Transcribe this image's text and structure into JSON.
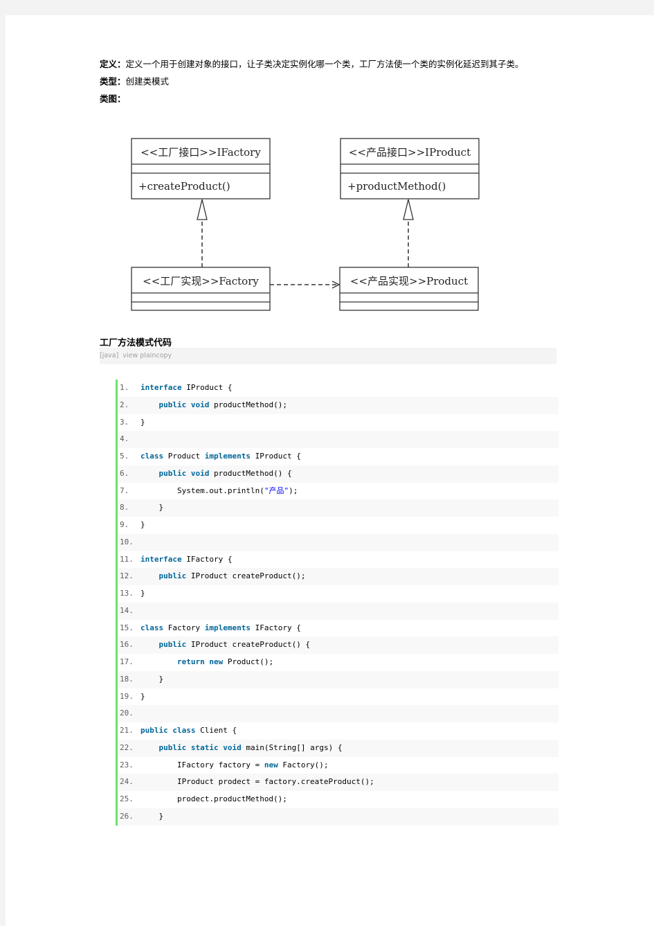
{
  "intro": {
    "definition_label": "定义：",
    "definition_text": "定义一个用于创建对象的接口，让子类决定实例化哪一个类，工厂方法使一个类的实例化延迟到其子类。",
    "type_label": "类型：",
    "type_text": "创建类模式",
    "diagram_label": "类图："
  },
  "diagram": {
    "classes": [
      {
        "id": "ifactory",
        "title": "<<工厂接口>>IFactory",
        "methods": [
          "+createProduct()"
        ]
      },
      {
        "id": "iproduct",
        "title": "<<产品接口>>IProduct",
        "methods": [
          "+productMethod()"
        ]
      },
      {
        "id": "factory",
        "title": "<<工厂实现>>Factory",
        "methods": []
      },
      {
        "id": "product",
        "title": "<<产品实现>>Product",
        "methods": []
      }
    ],
    "relations": [
      {
        "from": "factory",
        "to": "ifactory",
        "type": "realization"
      },
      {
        "from": "product",
        "to": "iproduct",
        "type": "realization"
      },
      {
        "from": "factory",
        "to": "product",
        "type": "dependency"
      }
    ]
  },
  "code_section": {
    "title": "工厂方法模式代码",
    "toolbar": {
      "language": "[java]",
      "view_plain": "view plain",
      "copy": "copy"
    },
    "lines": [
      {
        "n": "1.",
        "indent": 0,
        "tokens": [
          [
            "kw2",
            "interface"
          ],
          [
            "t",
            " IProduct {"
          ]
        ]
      },
      {
        "n": "2.",
        "indent": 1,
        "tokens": [
          [
            "kw",
            "public"
          ],
          [
            "t",
            " "
          ],
          [
            "kw2",
            "void"
          ],
          [
            "t",
            " productMethod();"
          ]
        ]
      },
      {
        "n": "3.",
        "indent": 0,
        "tokens": [
          [
            "t",
            "}"
          ]
        ]
      },
      {
        "n": "4.",
        "indent": 0,
        "tokens": []
      },
      {
        "n": "5.",
        "indent": 0,
        "tokens": [
          [
            "kw2",
            "class"
          ],
          [
            "t",
            " Product "
          ],
          [
            "kw",
            "implements"
          ],
          [
            "t",
            " IProduct {"
          ]
        ]
      },
      {
        "n": "6.",
        "indent": 1,
        "tokens": [
          [
            "kw",
            "public"
          ],
          [
            "t",
            " "
          ],
          [
            "kw2",
            "void"
          ],
          [
            "t",
            " productMethod() {"
          ]
        ]
      },
      {
        "n": "7.",
        "indent": 2,
        "tokens": [
          [
            "t",
            "System.out.println("
          ],
          [
            "str",
            "\"产品\""
          ],
          [
            "t",
            ");"
          ]
        ]
      },
      {
        "n": "8.",
        "indent": 1,
        "tokens": [
          [
            "t",
            "}"
          ]
        ]
      },
      {
        "n": "9.",
        "indent": 0,
        "tokens": [
          [
            "t",
            "}"
          ]
        ]
      },
      {
        "n": "10.",
        "indent": 0,
        "tokens": []
      },
      {
        "n": "11.",
        "indent": 0,
        "tokens": [
          [
            "kw2",
            "interface"
          ],
          [
            "t",
            " IFactory {"
          ]
        ]
      },
      {
        "n": "12.",
        "indent": 1,
        "tokens": [
          [
            "kw",
            "public"
          ],
          [
            "t",
            " IProduct createProduct();"
          ]
        ]
      },
      {
        "n": "13.",
        "indent": 0,
        "tokens": [
          [
            "t",
            "}"
          ]
        ]
      },
      {
        "n": "14.",
        "indent": 0,
        "tokens": []
      },
      {
        "n": "15.",
        "indent": 0,
        "tokens": [
          [
            "kw2",
            "class"
          ],
          [
            "t",
            " Factory "
          ],
          [
            "kw",
            "implements"
          ],
          [
            "t",
            " IFactory {"
          ]
        ]
      },
      {
        "n": "16.",
        "indent": 1,
        "tokens": [
          [
            "kw",
            "public"
          ],
          [
            "t",
            " IProduct createProduct() {"
          ]
        ]
      },
      {
        "n": "17.",
        "indent": 2,
        "tokens": [
          [
            "kw",
            "return"
          ],
          [
            "t",
            " "
          ],
          [
            "kw2",
            "new"
          ],
          [
            "t",
            " Product();"
          ]
        ]
      },
      {
        "n": "18.",
        "indent": 1,
        "tokens": [
          [
            "t",
            "}"
          ]
        ]
      },
      {
        "n": "19.",
        "indent": 0,
        "tokens": [
          [
            "t",
            "}"
          ]
        ]
      },
      {
        "n": "20.",
        "indent": 0,
        "tokens": []
      },
      {
        "n": "21.",
        "indent": 0,
        "tokens": [
          [
            "kw",
            "public"
          ],
          [
            "t",
            " "
          ],
          [
            "kw2",
            "class"
          ],
          [
            "t",
            " Client {"
          ]
        ]
      },
      {
        "n": "22.",
        "indent": 1,
        "tokens": [
          [
            "kw",
            "public"
          ],
          [
            "t",
            " "
          ],
          [
            "kw2",
            "static"
          ],
          [
            "t",
            " "
          ],
          [
            "kw2",
            "void"
          ],
          [
            "t",
            " main(String[] args) {"
          ]
        ]
      },
      {
        "n": "23.",
        "indent": 2,
        "tokens": [
          [
            "t",
            "IFactory factory = "
          ],
          [
            "kw2",
            "new"
          ],
          [
            "t",
            " Factory();"
          ]
        ]
      },
      {
        "n": "24.",
        "indent": 2,
        "tokens": [
          [
            "t",
            "IProduct prodect = factory.createProduct();"
          ]
        ]
      },
      {
        "n": "25.",
        "indent": 2,
        "tokens": [
          [
            "t",
            "prodect.productMethod();"
          ]
        ]
      },
      {
        "n": "26.",
        "indent": 1,
        "tokens": [
          [
            "t",
            "}"
          ]
        ]
      }
    ]
  },
  "colors": {
    "page_bg": "#f3f3f3",
    "keyword": "#006699",
    "string": "#0000ff",
    "gutter_border": "#6ce26c",
    "alt_row": "#f8f8f8"
  }
}
